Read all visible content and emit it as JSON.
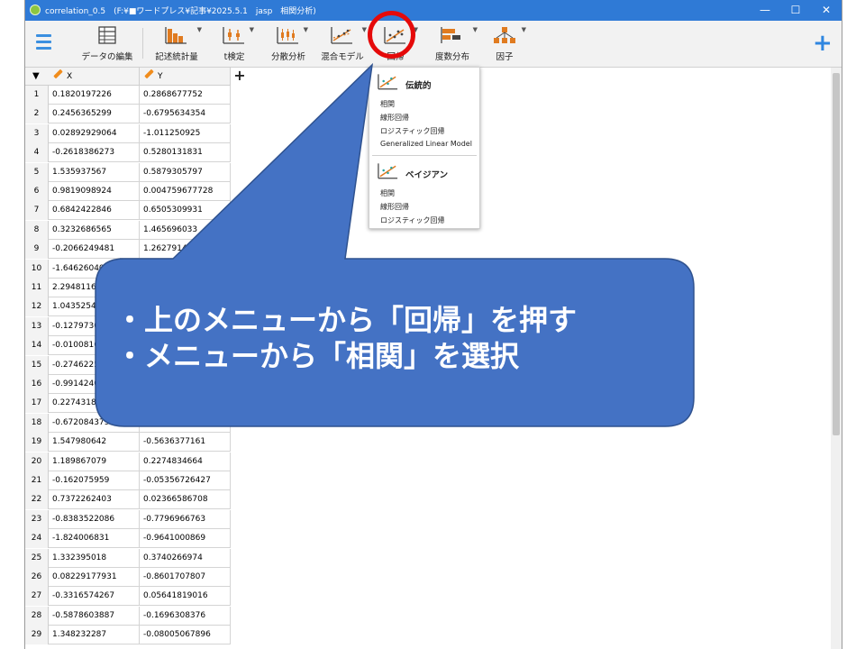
{
  "window": {
    "title": "correlation_0.5　(F:¥■ワードプレス¥記事¥2025.5.1　jasp　相関分析)",
    "controls": [
      "—",
      "☐",
      "✕"
    ]
  },
  "toolbar": {
    "items": [
      {
        "label": "データの編集",
        "icon": "data-editor-icon",
        "caret": false
      },
      {
        "label": "記述統計量",
        "icon": "descriptives-icon",
        "caret": true
      },
      {
        "label": "t検定",
        "icon": "ttest-icon",
        "caret": true
      },
      {
        "label": "分散分析",
        "icon": "anova-icon",
        "caret": true
      },
      {
        "label": "混合モデル",
        "icon": "mixed-models-icon",
        "caret": true
      },
      {
        "label": "回帰",
        "icon": "regression-icon",
        "caret": true
      },
      {
        "label": "度数分布",
        "icon": "frequencies-icon",
        "caret": true
      },
      {
        "label": "因子",
        "icon": "factor-icon",
        "caret": true
      }
    ],
    "plus": "+"
  },
  "grid": {
    "columns": [
      "X",
      "Y"
    ],
    "add_column": "+",
    "rows": [
      {
        "n": "1",
        "x": "0.1820197226",
        "y": "0.2868677752"
      },
      {
        "n": "2",
        "x": "0.2456365299",
        "y": "-0.6795634354"
      },
      {
        "n": "3",
        "x": "0.02892929064",
        "y": "-1.011250925"
      },
      {
        "n": "4",
        "x": "-0.2618386273",
        "y": "0.5280131831"
      },
      {
        "n": "5",
        "x": "1.535937567",
        "y": "0.5879305797"
      },
      {
        "n": "6",
        "x": "0.9819098924",
        "y": "0.004759677728"
      },
      {
        "n": "7",
        "x": "0.6842422846",
        "y": "0.6505309931"
      },
      {
        "n": "8",
        "x": "0.3232686565",
        "y": "1.465696033"
      },
      {
        "n": "9",
        "x": "-0.2066249481",
        "y": "1.262791439"
      },
      {
        "n": "10",
        "x": "-1.646260406",
        "y": ""
      },
      {
        "n": "11",
        "x": "2.29481166",
        "y": ""
      },
      {
        "n": "12",
        "x": "1.04352549",
        "y": ""
      },
      {
        "n": "13",
        "x": "-0.12797303",
        "y": ""
      },
      {
        "n": "14",
        "x": "-0.01008166",
        "y": ""
      },
      {
        "n": "15",
        "x": "-0.27462258",
        "y": ""
      },
      {
        "n": "16",
        "x": "-0.99142406",
        "y": ""
      },
      {
        "n": "17",
        "x": "0.22743180",
        "y": ""
      },
      {
        "n": "18",
        "x": "-0.6720843794",
        "y": ""
      },
      {
        "n": "19",
        "x": "1.547980642",
        "y": "-0.5636377161"
      },
      {
        "n": "20",
        "x": "1.189867079",
        "y": "0.2274834664"
      },
      {
        "n": "21",
        "x": "-0.162075959",
        "y": "-0.05356726427"
      },
      {
        "n": "22",
        "x": "0.7372262403",
        "y": "0.02366586708"
      },
      {
        "n": "23",
        "x": "-0.8383522086",
        "y": "-0.7796966763"
      },
      {
        "n": "24",
        "x": "-1.824006831",
        "y": "-0.9641000869"
      },
      {
        "n": "25",
        "x": "1.332395018",
        "y": "0.3740266974"
      },
      {
        "n": "26",
        "x": "0.08229177931",
        "y": "-0.8601707807"
      },
      {
        "n": "27",
        "x": "-0.3316574267",
        "y": "0.05641819016"
      },
      {
        "n": "28",
        "x": "-0.5878603887",
        "y": "-0.1696308376"
      },
      {
        "n": "29",
        "x": "1.348232287",
        "y": "-0.08005067896"
      }
    ]
  },
  "dropdown": {
    "classical": {
      "title": "伝統的",
      "items": [
        "相関",
        "線形回帰",
        "ロジスティック回帰",
        "Generalized Linear Model"
      ]
    },
    "bayesian": {
      "title": "ベイジアン",
      "items": [
        "相関",
        "線形回帰",
        "ロジスティック回帰"
      ]
    }
  },
  "annotation": {
    "lines": [
      "・上のメニューから「回帰」を押す",
      "・メニューから「相関」を選択"
    ],
    "callout_color": "#4472c4",
    "highlight_color": "#e50a0a"
  }
}
